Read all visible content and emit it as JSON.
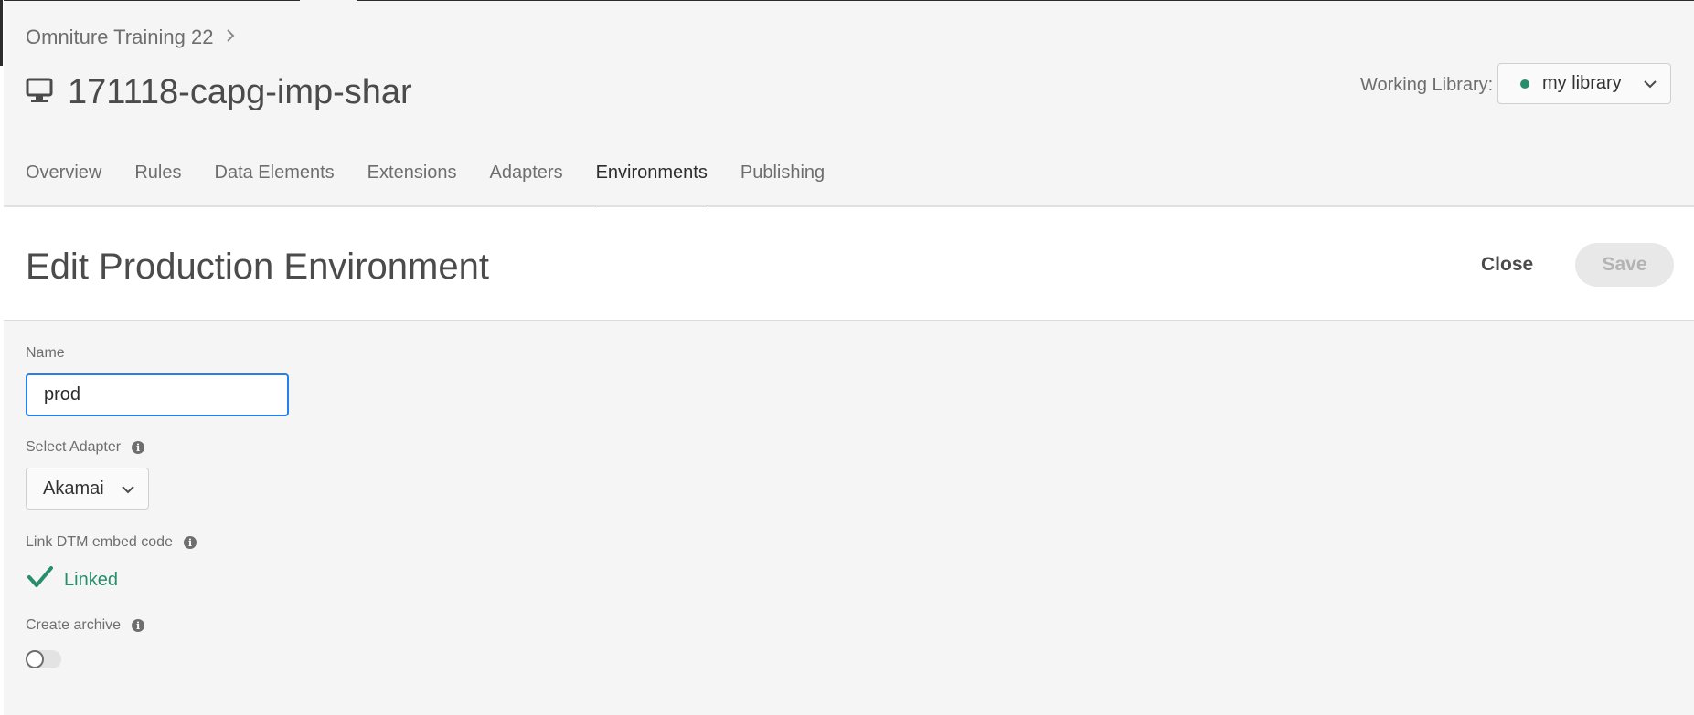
{
  "breadcrumb": {
    "company": "Omniture Training 22"
  },
  "property": {
    "name": "171118-capg-imp-shar",
    "icon": "desktop-icon"
  },
  "working_library": {
    "label": "Working Library:",
    "value": "my library",
    "status_color": "#268e6c"
  },
  "tabs": [
    {
      "label": "Overview",
      "active": false
    },
    {
      "label": "Rules",
      "active": false
    },
    {
      "label": "Data Elements",
      "active": false
    },
    {
      "label": "Extensions",
      "active": false
    },
    {
      "label": "Adapters",
      "active": false
    },
    {
      "label": "Environments",
      "active": true
    },
    {
      "label": "Publishing",
      "active": false
    }
  ],
  "editor": {
    "heading": "Edit Production Environment",
    "close_label": "Close",
    "save_label": "Save"
  },
  "form": {
    "name_label": "Name",
    "name_value": "prod",
    "adapter_label": "Select Adapter",
    "adapter_value": "Akamai",
    "embed_label": "Link DTM embed code",
    "embed_status": "Linked",
    "archive_label": "Create archive",
    "archive_enabled": false
  },
  "colors": {
    "accent": "#2680eb",
    "success": "#268e6c"
  }
}
